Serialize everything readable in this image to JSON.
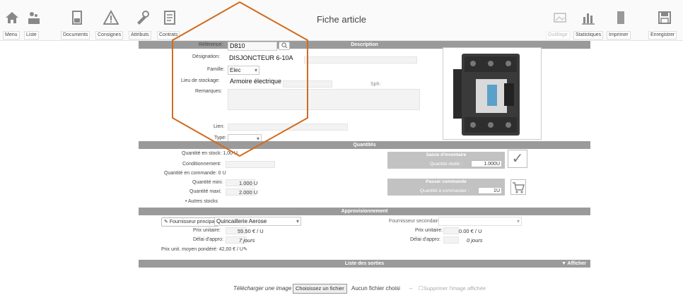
{
  "toolbar": {
    "title": "Fiche article",
    "menu": "Menu",
    "liste": "Liste",
    "documents": "Documents",
    "consignes": "Consignes",
    "attributs": "Attributs",
    "contrats": "Contrats",
    "outillage": "Outillage",
    "statistiques": "Statistiques",
    "imprimer": "Imprimer",
    "enregistrer": "Enregistrer"
  },
  "description": {
    "section_title": "Description",
    "reference_label": "Référence:",
    "reference_value": "D810",
    "designation_label": "Désignation:",
    "designation_value": "DISJONCTEUR 6-10A",
    "famille_label": "Famille:",
    "famille_value": "Elec",
    "lieu_label": "Lieu de stockage:",
    "lieu_value": "Armoire électrique",
    "remarques_label": "Remarques:",
    "lien_label": "Lien:",
    "type_label": "Type:",
    "sph_label": "Sph:"
  },
  "quantite": {
    "section_title": "Quantités",
    "stock_label": "Quantité en stock: 1,00 U",
    "conditionnement_label": "Conditionnement:",
    "commande_label": "Quantité en commande: 0 U",
    "mini_label": "Quantité mini:",
    "mini_value": "1.000 U",
    "maxi_label": "Quantité maxi:",
    "maxi_value": "2.000 U",
    "autres_stocks": "Autres stocks",
    "inventaire_title": "Saisie d'inventaire",
    "inventaire_qty_label": "Quantité réelle :",
    "inventaire_qty_value": "1.000U",
    "commande_title": "Passer commande",
    "commande_qty_label": "Quantité à commander :",
    "commande_qty_value": "1U"
  },
  "appro": {
    "section_title": "Approvisionnement",
    "fournisseur_principal_btn": "Fournisseur principal",
    "fournisseur_principal_value": "Quincaillerie Aerose",
    "prix_label": "Prix unitaire:",
    "prix_value": "55.50 € / U",
    "delai_label": "Délai d'appro:",
    "delai_value": "7 jours",
    "pmp_label": "Prix unit. moyen pondéré: 42,00 € / U",
    "fournisseur_secondaire_label": "Fournisseur secondaire:",
    "prix2_label": "Prix unitaire:",
    "prix2_value": "0.00 € / U",
    "delai2_label": "Délai d'appro:",
    "delai2_value": "0 jours"
  },
  "sorties": {
    "section_title": "Liste des sorties",
    "afficher": "▼ Afficher"
  },
  "upload": {
    "label": "Télécharger une image :",
    "button": "Choisissez un fichier",
    "no_file": "Aucun fichier choisi",
    "dash": "–",
    "delete_label": "Supprimer l'image affichée"
  }
}
